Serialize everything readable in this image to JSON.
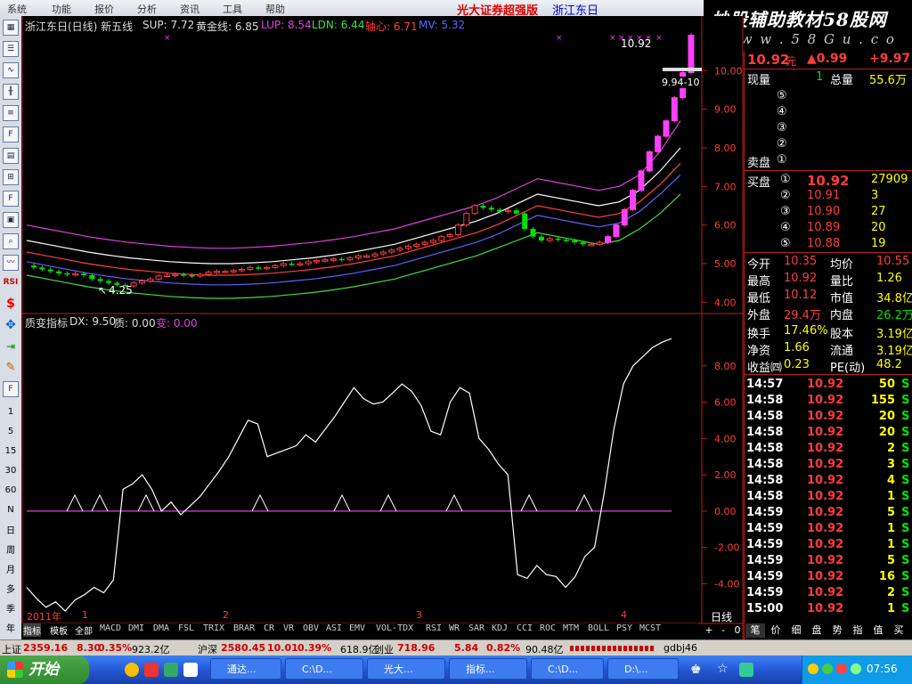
{
  "menu": [
    "系统",
    "功能",
    "报价",
    "分析",
    "资讯",
    "工具",
    "帮助"
  ],
  "menu_broker": "光大证券超强版",
  "menu_stock": "浙江东日",
  "banner": {
    "title": "炒股辅助教材58股网",
    "url": "w w w . 5 8 G u . c o m"
  },
  "left_toolbar": [
    "RSI",
    "1",
    "5",
    "15",
    "30",
    "60",
    "N",
    "日",
    "周",
    "月",
    "多",
    "季",
    "年"
  ],
  "main_header": {
    "title": "浙江东日(日线) 新五线",
    "sup": "SUP: 7.72",
    "gold": "黄金线: 6.85",
    "lup": "LUP: 8.54",
    "ldn": "LDN: 6.44",
    "core": "轴心: 6.71",
    "mv": "MV: 5.32"
  },
  "main_labels": {
    "high": "10.92",
    "low": "4.25",
    "price_range": "9.94-10"
  },
  "ind_header": {
    "title": "质变指标",
    "dx": "DX: 9.50",
    "zhi": "质: 0.00",
    "bian": "变: 0.00"
  },
  "x_axis": {
    "year": "2011年",
    "months": [
      "1",
      "2",
      "3",
      "4"
    ]
  },
  "timeframe": "日线",
  "chart_data": [
    {
      "type": "candlestick",
      "title": "浙江东日(日线) 新五线",
      "ylim": [
        3.8,
        11.0
      ],
      "y_ticks": [
        "10.00",
        "9.00",
        "8.00",
        "7.00",
        "6.00",
        "5.00",
        "4.00"
      ],
      "ohlc_open": [
        4.95,
        4.9,
        4.85,
        4.8,
        4.75,
        4.72,
        4.74,
        4.7,
        4.6,
        4.55,
        4.5,
        4.45,
        4.42,
        4.5,
        4.55,
        4.6,
        4.68,
        4.7,
        4.72,
        4.7,
        4.68,
        4.72,
        4.78,
        4.8,
        4.8,
        4.82,
        4.85,
        4.9,
        4.88,
        4.9,
        4.95,
        5.0,
        4.98,
        5.0,
        5.05,
        5.08,
        5.1,
        5.12,
        5.1,
        5.15,
        5.2,
        5.2,
        5.25,
        5.3,
        5.35,
        5.4,
        5.45,
        5.5,
        5.55,
        5.6,
        5.7,
        5.75,
        6.0,
        6.3,
        6.5,
        6.45,
        6.4,
        6.35,
        6.38,
        6.3,
        5.9,
        5.7,
        5.6,
        5.65,
        5.62,
        5.6,
        5.55,
        5.5,
        5.5,
        5.55,
        5.7,
        6.0,
        6.4,
        6.9,
        7.4,
        7.9,
        8.3,
        8.7,
        9.3,
        9.95
      ],
      "ohlc_close": [
        4.9,
        4.85,
        4.8,
        4.75,
        4.72,
        4.74,
        4.7,
        4.6,
        4.55,
        4.5,
        4.45,
        4.42,
        4.5,
        4.55,
        4.6,
        4.68,
        4.7,
        4.72,
        4.7,
        4.68,
        4.72,
        4.78,
        4.8,
        4.8,
        4.82,
        4.85,
        4.9,
        4.88,
        4.9,
        4.95,
        5.0,
        4.98,
        5.0,
        5.05,
        5.08,
        5.1,
        5.12,
        5.1,
        5.15,
        5.2,
        5.2,
        5.25,
        5.3,
        5.35,
        5.4,
        5.45,
        5.5,
        5.55,
        5.6,
        5.7,
        5.75,
        6.0,
        6.3,
        6.5,
        6.45,
        6.4,
        6.35,
        6.38,
        6.3,
        5.9,
        5.7,
        5.6,
        5.65,
        5.62,
        5.6,
        5.55,
        5.5,
        5.5,
        5.55,
        5.7,
        6.0,
        6.4,
        6.9,
        7.4,
        7.9,
        8.3,
        8.7,
        9.3,
        9.95,
        10.92
      ],
      "series": [
        {
          "values": [
            6.0,
            5.9,
            5.8,
            5.7,
            5.62,
            5.55,
            5.5,
            5.45,
            5.42,
            5.4,
            5.4,
            5.42,
            5.45,
            5.5,
            5.55,
            5.62,
            5.7,
            5.8,
            5.9,
            6.05,
            6.2,
            6.35,
            6.5,
            6.7,
            6.95,
            7.2,
            7.1,
            7.0,
            6.9,
            7.0,
            7.3,
            7.9,
            8.7
          ],
          "color": "#e040e0"
        },
        {
          "values": [
            5.6,
            5.5,
            5.4,
            5.3,
            5.22,
            5.15,
            5.1,
            5.05,
            5.02,
            5.0,
            5.0,
            5.02,
            5.05,
            5.1,
            5.15,
            5.22,
            5.3,
            5.4,
            5.5,
            5.65,
            5.8,
            5.95,
            6.1,
            6.3,
            6.55,
            6.8,
            6.7,
            6.6,
            6.5,
            6.6,
            6.9,
            7.4,
            8.0
          ],
          "color": "#ffffff"
        },
        {
          "values": [
            5.3,
            5.2,
            5.1,
            5.0,
            4.92,
            4.85,
            4.8,
            4.75,
            4.72,
            4.7,
            4.7,
            4.72,
            4.75,
            4.8,
            4.85,
            4.92,
            5.0,
            5.1,
            5.2,
            5.35,
            5.5,
            5.65,
            5.8,
            6.0,
            6.25,
            6.5,
            6.4,
            6.3,
            6.2,
            6.3,
            6.6,
            7.05,
            7.6
          ],
          "color": "#ff4040"
        },
        {
          "values": [
            5.05,
            4.95,
            4.85,
            4.75,
            4.67,
            4.6,
            4.55,
            4.5,
            4.47,
            4.45,
            4.45,
            4.47,
            4.5,
            4.55,
            4.6,
            4.67,
            4.75,
            4.85,
            4.95,
            5.1,
            5.25,
            5.4,
            5.55,
            5.75,
            6.0,
            6.25,
            6.15,
            6.05,
            5.95,
            6.05,
            6.35,
            6.8,
            7.3
          ],
          "color": "#6060ff"
        },
        {
          "values": [
            4.7,
            4.6,
            4.5,
            4.4,
            4.32,
            4.25,
            4.2,
            4.15,
            4.12,
            4.1,
            4.1,
            4.12,
            4.15,
            4.2,
            4.25,
            4.32,
            4.4,
            4.5,
            4.6,
            4.75,
            4.9,
            5.05,
            5.2,
            5.4,
            5.6,
            5.8,
            5.7,
            5.6,
            5.5,
            5.6,
            5.9,
            6.3,
            6.8
          ],
          "color": "#40e040"
        }
      ]
    },
    {
      "type": "line",
      "title": "质变指标",
      "ylim": [
        -5.5,
        10.0
      ],
      "y_ticks": [
        "8.00",
        "6.00",
        "4.00",
        "2.00",
        "0.00",
        "-2.00",
        "-4.00"
      ],
      "series": [
        {
          "name": "DX",
          "values": [
            -4.2,
            -4.8,
            -5.3,
            -5.0,
            -5.5,
            -4.9,
            -4.6,
            -4.2,
            -4.5,
            -3.8,
            1.2,
            1.5,
            2.0,
            1.2,
            0.0,
            0.5,
            -0.2,
            0.3,
            0.8,
            1.5,
            2.2,
            3.0,
            4.0,
            5.0,
            4.8,
            3.0,
            3.2,
            3.4,
            3.6,
            4.2,
            3.8,
            4.5,
            5.2,
            6.0,
            6.8,
            6.2,
            5.9,
            6.0,
            6.5,
            7.0,
            6.6,
            5.8,
            4.4,
            4.2,
            6.0,
            6.8,
            6.5,
            4.0,
            3.4,
            2.6,
            2.0,
            -3.5,
            -3.7,
            -3.0,
            -3.5,
            -3.6,
            -4.2,
            -3.6,
            -2.5,
            -2.0,
            1.0,
            4.5,
            7.0,
            8.0,
            8.5,
            9.0,
            9.3,
            9.5
          ],
          "color": "#ffffff"
        }
      ],
      "zero_line_color": "#e040e0",
      "markers_x": [
        2,
        3,
        5,
        9,
        13,
        16,
        20,
        23,
        25
      ]
    }
  ],
  "rp_header": {
    "price": "10.92",
    "unit": "元",
    "change": "▲0.99",
    "pct": "+9.97"
  },
  "rp_volume": [
    {
      "label": "现量",
      "val": "1",
      "label2": "总量",
      "val2": "55.6万"
    }
  ],
  "order_book": {
    "sell": [
      {
        "n": "⑤"
      },
      {
        "n": "④"
      },
      {
        "n": "③"
      },
      {
        "n": "②"
      },
      {
        "label": "卖盘",
        "n": "①"
      }
    ],
    "buy": [
      {
        "label": "买盘",
        "n": "①",
        "price": "10.92",
        "vol": "27909"
      },
      {
        "n": "②",
        "price": "10.91",
        "vol": "3"
      },
      {
        "n": "③",
        "price": "10.90",
        "vol": "27"
      },
      {
        "n": "④",
        "price": "10.89",
        "vol": "20"
      },
      {
        "n": "⑤",
        "price": "10.88",
        "vol": "19"
      }
    ]
  },
  "stats": [
    {
      "k1": "今开",
      "v1": "10.35",
      "k2": "均价",
      "v2": "10.55"
    },
    {
      "k1": "最高",
      "v1": "10.92",
      "k2": "量比",
      "v2": "1.26"
    },
    {
      "k1": "最低",
      "v1": "10.12",
      "k2": "市值",
      "v2": "34.8亿"
    },
    {
      "k1": "外盘",
      "v1": "29.4万",
      "k2": "内盘",
      "v2": "26.2万"
    },
    {
      "k1": "换手",
      "v1": "17.46%",
      "k2": "股本",
      "v2": "3.19亿"
    },
    {
      "k1": "净资",
      "v1": "1.66",
      "k2": "流通",
      "v2": "3.19亿"
    },
    {
      "k1": "收益㈣",
      "v1": "0.23",
      "k2": "PE(动)",
      "v2": "48.2"
    }
  ],
  "ticks": [
    {
      "t": "14:57",
      "p": "10.92",
      "v": "50",
      "s": "S"
    },
    {
      "t": "14:58",
      "p": "10.92",
      "v": "155",
      "s": "S"
    },
    {
      "t": "14:58",
      "p": "10.92",
      "v": "20",
      "s": "S"
    },
    {
      "t": "14:58",
      "p": "10.92",
      "v": "20",
      "s": "S"
    },
    {
      "t": "14:58",
      "p": "10.92",
      "v": "2",
      "s": "S"
    },
    {
      "t": "14:58",
      "p": "10.92",
      "v": "3",
      "s": "S"
    },
    {
      "t": "14:58",
      "p": "10.92",
      "v": "4",
      "s": "S"
    },
    {
      "t": "14:58",
      "p": "10.92",
      "v": "1",
      "s": "S"
    },
    {
      "t": "14:59",
      "p": "10.92",
      "v": "5",
      "s": "S"
    },
    {
      "t": "14:59",
      "p": "10.92",
      "v": "1",
      "s": "S"
    },
    {
      "t": "14:59",
      "p": "10.92",
      "v": "1",
      "s": "S"
    },
    {
      "t": "14:59",
      "p": "10.92",
      "v": "5",
      "s": "S"
    },
    {
      "t": "14:59",
      "p": "10.92",
      "v": "16",
      "s": "S"
    },
    {
      "t": "14:59",
      "p": "10.92",
      "v": "2",
      "s": "S"
    },
    {
      "t": "15:00",
      "p": "10.92",
      "v": "1",
      "s": "S"
    }
  ],
  "right_tabs": [
    "笔",
    "价",
    "细",
    "盘",
    "势",
    "指",
    "值",
    "买"
  ],
  "right_nav": [
    "+",
    "-",
    "0"
  ],
  "bottom_tabs": [
    "指标",
    "模板",
    "全部",
    "MACD",
    "DMI",
    "DMA",
    "FSL",
    "TRIX",
    "BRAR",
    "CR",
    "VR",
    "OBV",
    "ASI",
    "EMV",
    "VOL-TDX",
    "RSI",
    "WR",
    "SAR",
    "KDJ",
    "CCI",
    "ROC",
    "MTM",
    "BOLL",
    "PSY",
    "MCST"
  ],
  "status": [
    {
      "k": "上证",
      "v": "2359.16",
      "c": "8.30",
      "p": "0.35%",
      "a": "923.2亿"
    },
    {
      "k": "沪深",
      "v": "2580.45",
      "c": "10.01",
      "p": "0.39%",
      "a": "618.9亿"
    },
    {
      "k": "创业",
      "v": "718.96",
      "c": "5.84",
      "p": "0.82%",
      "a": "90.48亿"
    }
  ],
  "status_user": "gdbj46",
  "taskbar": {
    "start": "开始",
    "tasks": [
      "通达...",
      "C:\\D...",
      "光大...",
      "指标...",
      "C:\\D...",
      "D:\\..."
    ],
    "clock": "07:56"
  }
}
